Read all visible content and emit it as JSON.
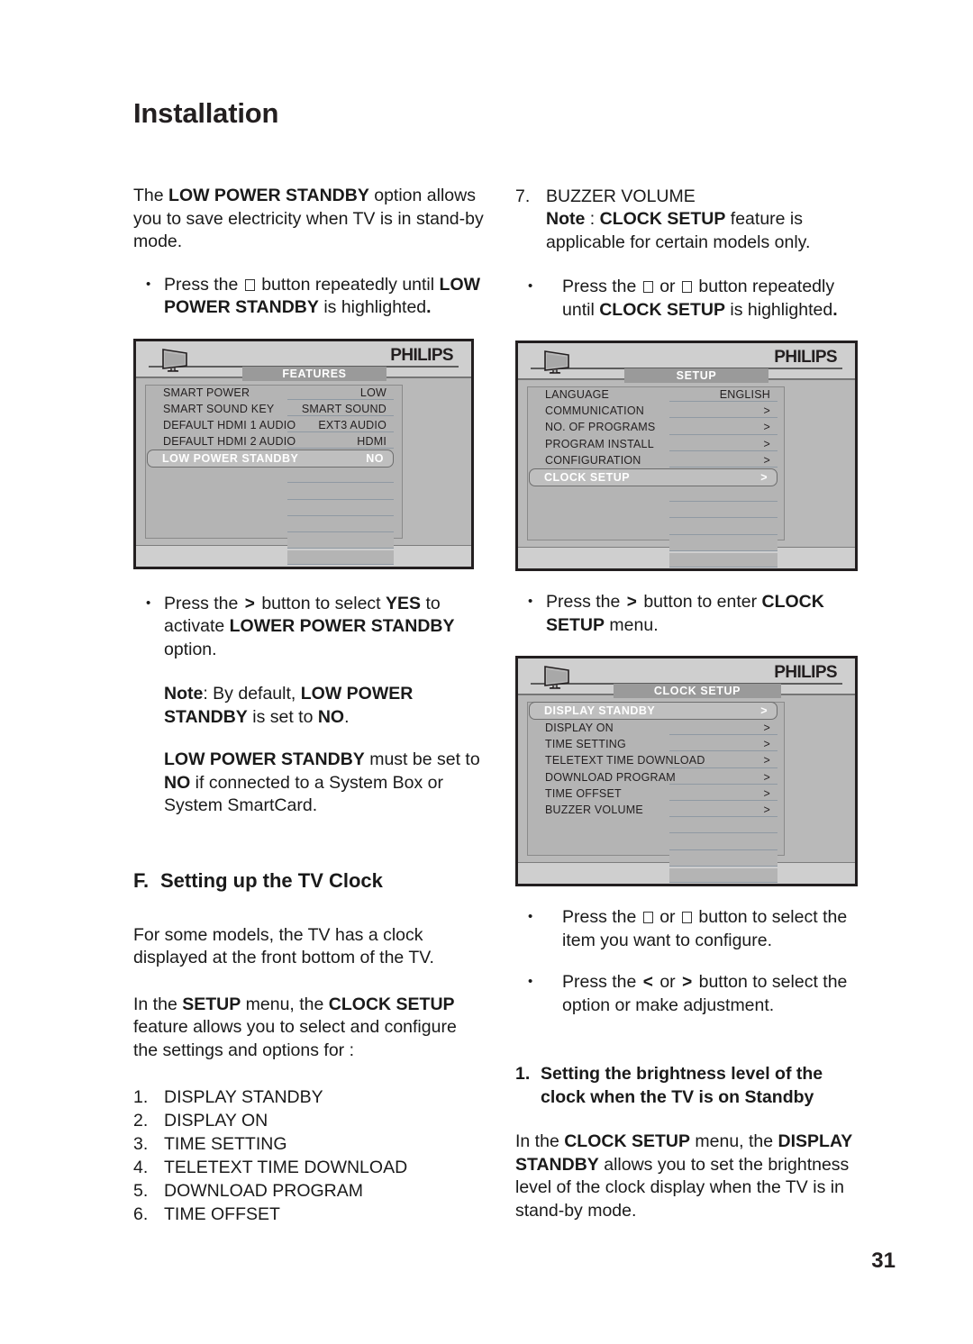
{
  "chapter": {
    "title": "Installation"
  },
  "page": {
    "number": "31"
  },
  "left_column": {
    "intro": {
      "prefix": "The ",
      "bold1": "LOW POWER STANDBY",
      "rest": " option allows you to save electricity when TV is in stand-by mode."
    },
    "bullet1": {
      "a": "Press the ",
      "b": " button repeatedly until ",
      "bold": "LOW POWER STANDBY",
      "c": " is highlighted",
      "period": "."
    },
    "menu_features": {
      "brand": "PHILIPS",
      "tab": "FEATURES",
      "rows": [
        {
          "label": "SMART POWER",
          "value": "LOW",
          "highlight": false
        },
        {
          "label": "SMART SOUND KEY",
          "value": "SMART SOUND",
          "highlight": false
        },
        {
          "label": "DEFAULT HDMI 1 AUDIO",
          "value": "EXT3 AUDIO",
          "highlight": false
        },
        {
          "label": "DEFAULT HDMI 2 AUDIO",
          "value": "HDMI",
          "highlight": false
        },
        {
          "label": "LOW POWER STANDBY",
          "value": "NO",
          "highlight": true
        },
        {
          "label": "",
          "value": "",
          "highlight": false
        },
        {
          "label": "",
          "value": "",
          "highlight": false
        },
        {
          "label": "",
          "value": "",
          "highlight": false
        },
        {
          "label": "",
          "value": "",
          "highlight": false
        },
        {
          "label": "",
          "value": "",
          "highlight": false
        },
        {
          "label": "",
          "value": "",
          "highlight": false
        }
      ]
    },
    "bullet2": {
      "a": "Press the ",
      "arrow": ">",
      "b": " button to select ",
      "bold1": "YES",
      "c": " to activate ",
      "bold2": "LOWER POWER STANDBY",
      "d": " option."
    },
    "note1": {
      "boldnote": "Note",
      "a": ": By default, ",
      "bold1": "LOW POWER STANDBY",
      "b": " is set to ",
      "bold2": "NO",
      "c": "."
    },
    "note2": {
      "bold1": "LOW POWER STANDBY",
      "a": " must be set to ",
      "bold2": "NO",
      "b": " if connected to a System Box or System SmartCard."
    },
    "section": {
      "letter": "F.",
      "title": "Setting up the TV Clock"
    },
    "clock_intro1": "For some models, the TV has a clock displayed at the front bottom of the TV.",
    "clock_intro2": {
      "a": "In the ",
      "bold1": "SETUP",
      "b": " menu, the ",
      "bold2": "CLOCK SETUP",
      "c": " feature allows you to select and configure the settings and options for :"
    },
    "clock_items": [
      {
        "n": "1.",
        "label": "DISPLAY STANDBY"
      },
      {
        "n": "2.",
        "label": "DISPLAY ON"
      },
      {
        "n": "3.",
        "label": "TIME SETTING"
      },
      {
        "n": "4.",
        "label": "TELETEXT TIME DOWNLOAD"
      },
      {
        "n": "5.",
        "label": "DOWNLOAD PROGRAM"
      },
      {
        "n": "6.",
        "label": "TIME OFFSET"
      }
    ]
  },
  "right_column": {
    "clock_item7": {
      "n": "7.",
      "label": "BUZZER VOLUME"
    },
    "note_clock": {
      "boldnote": "Note",
      "a": " : ",
      "bold1": "CLOCK SETUP",
      "b": " feature is applicable for certain models only."
    },
    "bullet1": {
      "a": "Press the ",
      "b": " or ",
      "c": " button repeatedly until ",
      "bold": "CLOCK SETUP",
      "d": " is highlighted",
      "period": "."
    },
    "menu_setup": {
      "brand": "PHILIPS",
      "tab": "SETUP",
      "rows": [
        {
          "label": "LANGUAGE",
          "value": "ENGLISH",
          "highlight": false
        },
        {
          "label": "COMMUNICATION",
          "value": ">",
          "highlight": false
        },
        {
          "label": "NO. OF PROGRAMS",
          "value": ">",
          "highlight": false
        },
        {
          "label": "PROGRAM INSTALL",
          "value": ">",
          "highlight": false
        },
        {
          "label": "CONFIGURATION",
          "value": ">",
          "highlight": false
        },
        {
          "label": "CLOCK SETUP",
          "value": ">",
          "highlight": true
        },
        {
          "label": "",
          "value": "",
          "highlight": false
        },
        {
          "label": "",
          "value": "",
          "highlight": false
        },
        {
          "label": "",
          "value": "",
          "highlight": false
        },
        {
          "label": "",
          "value": "",
          "highlight": false
        },
        {
          "label": "",
          "value": "",
          "highlight": false
        }
      ]
    },
    "bullet2": {
      "a": "Press the ",
      "arrow": ">",
      "b": " button to enter ",
      "bold": "CLOCK SETUP",
      "c": " menu."
    },
    "menu_clock_setup": {
      "brand": "PHILIPS",
      "tab": "CLOCK SETUP",
      "rows": [
        {
          "label": "DISPLAY STANDBY",
          "value": ">",
          "highlight": true
        },
        {
          "label": "DISPLAY ON",
          "value": ">",
          "highlight": false
        },
        {
          "label": "TIME SETTING",
          "value": ">",
          "highlight": false
        },
        {
          "label": "TELETEXT TIME DOWNLOAD",
          "value": ">",
          "highlight": false
        },
        {
          "label": "DOWNLOAD PROGRAM",
          "value": ">",
          "highlight": false
        },
        {
          "label": "TIME OFFSET",
          "value": ">",
          "highlight": false
        },
        {
          "label": "BUZZER VOLUME",
          "value": ">",
          "highlight": false
        },
        {
          "label": "",
          "value": "",
          "highlight": false
        },
        {
          "label": "",
          "value": "",
          "highlight": false
        },
        {
          "label": "",
          "value": "",
          "highlight": false
        },
        {
          "label": "",
          "value": "",
          "highlight": false
        }
      ]
    },
    "bullet3": {
      "a": "Press the ",
      "b": " or ",
      "c": " button to select the item you want to configure."
    },
    "bullet4": {
      "a": "Press the ",
      "arrow1": "<",
      "b": " or ",
      "arrow2": ">",
      "c": " button to select the option or make adjustment."
    },
    "subhead1": {
      "n": "1.",
      "title": "Setting the brightness level of the clock when the TV is on Standby"
    },
    "closing": {
      "a": "In the ",
      "bold1": "CLOCK SETUP",
      "b": " menu, the ",
      "bold2": "DISPLAY STANDBY",
      "c": " allows you to set the brightness level of the clock display when the TV is in stand-by mode."
    }
  },
  "colors": {
    "ink": "#231f20",
    "osd_border": "#231f20",
    "osd_header": "#cfcfcf",
    "osd_body": "#b9b9b9",
    "osd_tab": "#9a9a9a",
    "osd_highlight": "#bfbfbf"
  }
}
